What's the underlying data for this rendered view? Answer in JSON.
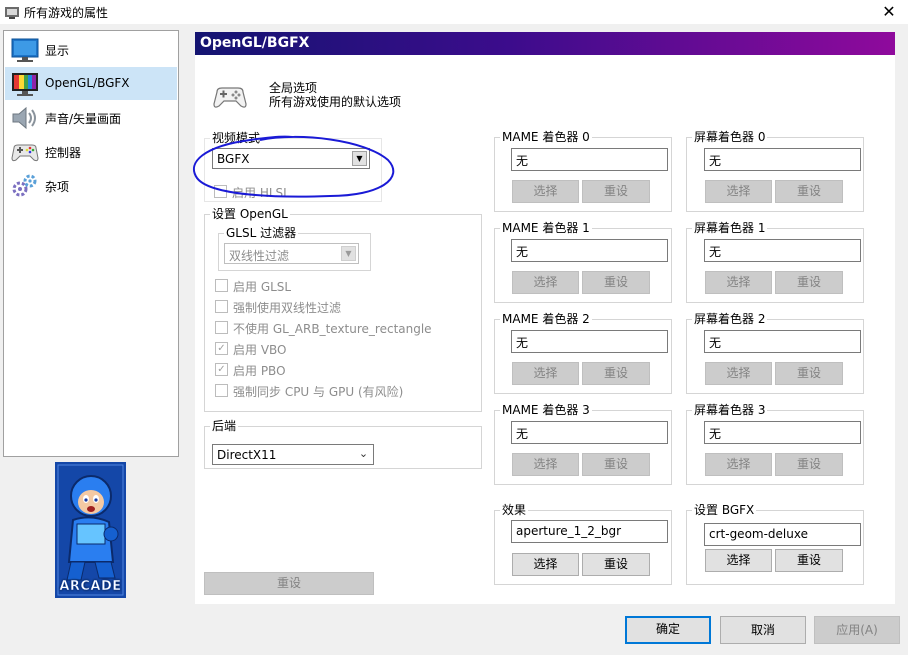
{
  "window": {
    "title": "所有游戏的属性",
    "close_glyph": "✕"
  },
  "nav": {
    "items": [
      {
        "label": "显示",
        "icon": "monitor-icon"
      },
      {
        "label": "OpenGL/BGFX",
        "icon": "color-monitor-icon",
        "selected": true
      },
      {
        "label": "声音/矢量画面",
        "icon": "speaker-icon"
      },
      {
        "label": "控制器",
        "icon": "gamepad-icon"
      },
      {
        "label": "杂项",
        "icon": "gears-icon"
      }
    ]
  },
  "arcade_logo_text": "ARCADE",
  "panel": {
    "header": "OpenGL/BGFX",
    "scope_line1": "全局选项",
    "scope_line2": "所有游戏使用的默认选项"
  },
  "video": {
    "legend": "视频模式",
    "mode_value": "BGFX",
    "hlsl_label": "启用 HLSL"
  },
  "opengl": {
    "legend": "设置 OpenGL",
    "glsl_filter_legend": "GLSL 过滤器",
    "glsl_filter_value": "双线性过滤",
    "options": [
      {
        "label": "启用 GLSL",
        "checked": false
      },
      {
        "label": "强制使用双线性过滤",
        "checked": false
      },
      {
        "label": "不使用 GL_ARB_texture_rectangle",
        "checked": false
      },
      {
        "label": "启用 VBO",
        "checked": true
      },
      {
        "label": "启用 PBO",
        "checked": true
      },
      {
        "label": "强制同步 CPU 与 GPU (有风险)",
        "checked": false
      }
    ]
  },
  "backend": {
    "legend": "后端",
    "value": "DirectX11"
  },
  "reset_left": "重设",
  "mame_shaders": [
    {
      "legend": "MAME 着色器 0",
      "value": "无",
      "choose": "选择",
      "reset": "重设"
    },
    {
      "legend": "MAME 着色器 1",
      "value": "无",
      "choose": "选择",
      "reset": "重设"
    },
    {
      "legend": "MAME 着色器 2",
      "value": "无",
      "choose": "选择",
      "reset": "重设"
    },
    {
      "legend": "MAME 着色器 3",
      "value": "无",
      "choose": "选择",
      "reset": "重设"
    }
  ],
  "screen_shaders": [
    {
      "legend": "屏幕着色器 0",
      "value": "无",
      "choose": "选择",
      "reset": "重设"
    },
    {
      "legend": "屏幕着色器 1",
      "value": "无",
      "choose": "选择",
      "reset": "重设"
    },
    {
      "legend": "屏幕着色器 2",
      "value": "无",
      "choose": "选择",
      "reset": "重设"
    },
    {
      "legend": "屏幕着色器 3",
      "value": "无",
      "choose": "选择",
      "reset": "重设"
    }
  ],
  "effect": {
    "legend": "效果",
    "value": "aperture_1_2_bgr",
    "choose": "选择",
    "reset": "重设"
  },
  "bgfx": {
    "legend": "设置 BGFX",
    "value": "crt-geom-deluxe",
    "choose": "选择",
    "reset": "重设"
  },
  "footer": {
    "ok": "确定",
    "cancel": "取消",
    "apply": "应用(A)"
  },
  "colors": {
    "header_gradient_start": "#141471",
    "header_gradient_end": "#8f0a9c",
    "nav_selected": "#cce4f7",
    "annotation_stroke": "#1a1ad6",
    "primary_border": "#0078d7"
  }
}
